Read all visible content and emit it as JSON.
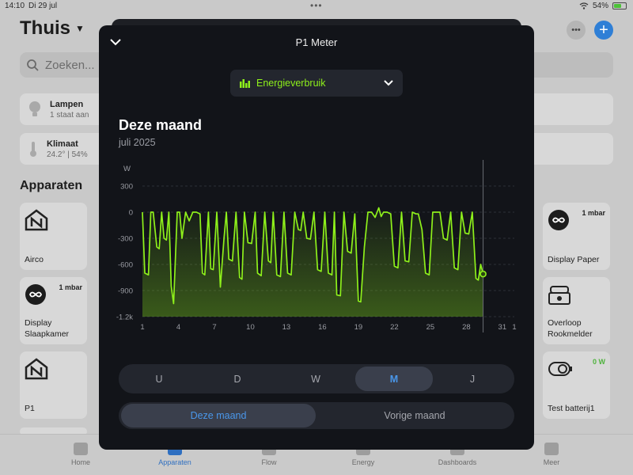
{
  "status_bar": {
    "time": "14:10",
    "date": "Di 29 jul",
    "battery": "54%"
  },
  "background": {
    "title": "Thuis",
    "search_placeholder": "Zoeken...",
    "zones": [
      {
        "name": "Lampen",
        "status": "1 staat aan"
      },
      {
        "name": "Klimaat",
        "status": "24.2° | 54%"
      }
    ],
    "section_title": "Apparaten",
    "devices_left": [
      "Airco",
      "Display Slaapkamer",
      "P1"
    ],
    "devices_left_badge": "1 mbar",
    "devices_right": [
      "Display Paper",
      "Overloop Rookmelder",
      "Test batterij1"
    ],
    "devices_right_badges": [
      "1 mbar",
      "",
      "0 W"
    ],
    "tabs": [
      "Home",
      "Apparaten",
      "Flow",
      "Energy",
      "Dashboards",
      "Meer"
    ]
  },
  "modal": {
    "title": "P1 Meter",
    "selector_label": "Energieverbruik",
    "period_title": "Deze maand",
    "period_subtitle": "juli 2025",
    "range_buttons": [
      "U",
      "D",
      "W",
      "M",
      "J"
    ],
    "range_active": "M",
    "month_buttons": [
      "Deze maand",
      "Vorige maand"
    ],
    "month_active": "Deze maand"
  },
  "colors": {
    "accent_green": "#8ef01b",
    "accent_blue": "#4a97ea",
    "modal_bg": "#121419"
  },
  "chart_data": {
    "type": "area",
    "unit": "W",
    "yticks": [
      300,
      0,
      -300,
      -600,
      -900,
      -1200
    ],
    "ytick_labels": [
      "300",
      "0",
      "-300",
      "-600",
      "-900",
      "-1.2k"
    ],
    "ylim": [
      -1200,
      300
    ],
    "xlim": [
      1,
      32
    ],
    "xticks": [
      1,
      4,
      7,
      10,
      13,
      16,
      19,
      22,
      25,
      28,
      31,
      32
    ],
    "xtick_labels": [
      "1",
      "4",
      "7",
      "10",
      "13",
      "16",
      "19",
      "22",
      "25",
      "28",
      "31",
      "1"
    ],
    "cursor_day": 29.4,
    "cursor_value": -710,
    "series": [
      {
        "x": [
          1.0,
          1.2,
          1.5,
          1.7,
          1.9,
          2.2,
          2.4,
          2.6,
          2.8,
          3.0,
          3.2,
          3.4,
          3.6,
          3.9,
          4.1,
          4.3,
          4.6,
          4.9,
          5.2,
          5.5,
          5.8,
          6.0,
          6.2,
          6.5,
          6.7,
          6.9,
          7.2,
          7.5,
          7.8,
          8.0,
          8.2,
          8.5,
          8.8,
          9.1,
          9.3,
          9.5,
          9.8,
          10.1,
          10.4,
          10.6,
          10.9,
          11.2,
          11.5,
          11.7,
          11.9,
          12.2,
          12.5,
          12.8,
          13.1,
          13.4,
          13.7,
          14.0,
          14.2,
          14.4,
          14.7,
          15.0,
          15.3,
          15.6,
          15.9,
          16.2,
          16.5,
          16.8,
          17.0,
          17.2,
          17.5,
          17.8,
          18.1,
          18.4,
          18.7,
          19.0,
          19.2,
          19.5,
          19.8,
          20.1,
          20.4,
          20.7,
          20.9,
          21.1,
          21.4,
          21.7,
          22.0,
          22.3,
          22.6,
          22.9,
          23.2,
          23.5,
          23.8,
          24.0,
          24.3,
          24.6,
          24.9,
          25.2,
          25.5,
          25.8,
          26.1,
          26.4,
          26.7,
          27.0,
          27.3,
          27.6,
          27.9,
          28.2,
          28.5,
          28.8,
          29.0,
          29.2,
          29.4
        ],
        "y": [
          0,
          -700,
          -720,
          0,
          0,
          -400,
          -420,
          0,
          -300,
          -320,
          0,
          -850,
          -1050,
          0,
          0,
          -300,
          0,
          -100,
          0,
          0,
          -20,
          -700,
          -720,
          0,
          -650,
          -660,
          0,
          -860,
          -300,
          0,
          -540,
          -560,
          0,
          -750,
          -770,
          0,
          -350,
          -360,
          0,
          -700,
          -730,
          0,
          -560,
          -580,
          0,
          -720,
          -740,
          0,
          -700,
          -720,
          0,
          -200,
          -210,
          0,
          -300,
          -310,
          0,
          -660,
          -680,
          0,
          -700,
          -720,
          0,
          -950,
          -960,
          0,
          -450,
          -470,
          -20,
          -1020,
          -1030,
          -400,
          0,
          0,
          -60,
          50,
          -50,
          0,
          0,
          -20,
          -620,
          -640,
          0,
          -560,
          -570,
          0,
          -20,
          -20,
          -200,
          -700,
          -720,
          0,
          0,
          0,
          -300,
          -320,
          0,
          -640,
          -660,
          0,
          -240,
          -250,
          0,
          -760,
          -780,
          -600,
          -710
        ]
      }
    ]
  }
}
